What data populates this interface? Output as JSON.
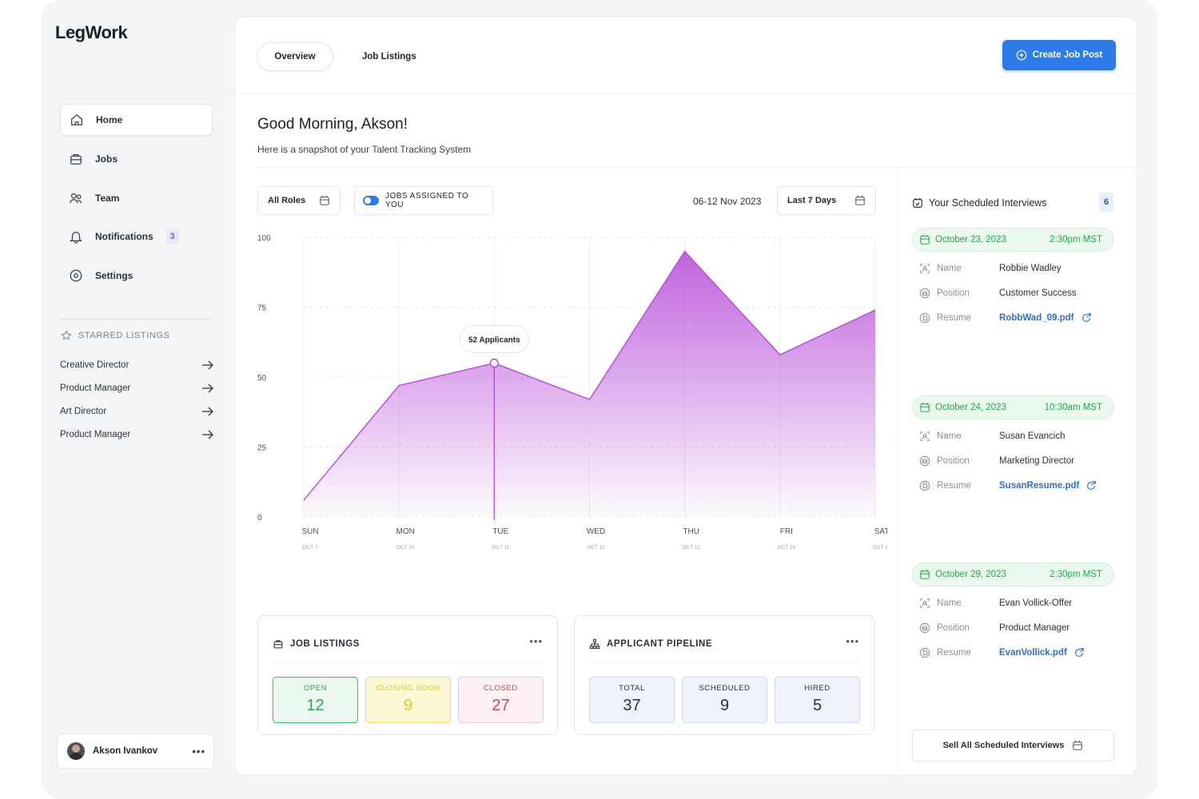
{
  "app": {
    "logo": "LegWork"
  },
  "sidebar": {
    "items": [
      {
        "label": "Home",
        "icon": "home-icon",
        "active": true
      },
      {
        "label": "Jobs",
        "icon": "briefcase-icon"
      },
      {
        "label": "Team",
        "icon": "team-icon"
      },
      {
        "label": "Notifications",
        "icon": "bell-icon",
        "badge": "3"
      },
      {
        "label": "Settings",
        "icon": "settings-icon"
      }
    ],
    "starred_title": "STARRED LISTINGS",
    "starred": [
      "Creative Director",
      "Product Manager",
      "Art Director",
      "Product Manager"
    ],
    "user": {
      "name": "Akson Ivankov"
    }
  },
  "header": {
    "tabs": [
      "Overview",
      "Job Listings"
    ],
    "create_button": "Create Job Post"
  },
  "greeting": {
    "title": "Good Morning, Akson!",
    "subtitle": "Here is a snapshot of your Talent Tracking System"
  },
  "filters": {
    "roles": "All Roles",
    "toggle_label": "JOBS ASSIGNED TO YOU",
    "date_range": "06-12 Nov 2023",
    "period": "Last 7 Days"
  },
  "chart_data": {
    "type": "area",
    "categories": [
      "SUN",
      "MON",
      "TUE",
      "WED",
      "THU",
      "FRI",
      "SAT"
    ],
    "sublabels": [
      "OCT 7",
      "OCT 10",
      "OCT 11",
      "OCT 12",
      "OCT 13",
      "OCT 14",
      "OCT 15"
    ],
    "values": [
      6,
      47,
      55,
      42,
      95,
      58,
      74
    ],
    "ylim": [
      0,
      100
    ],
    "yticks": [
      0,
      25,
      50,
      75,
      100
    ],
    "tooltip": {
      "index": 2,
      "label": "52 Applicants"
    },
    "color": "#b548d8"
  },
  "job_listings": {
    "title": "JOB LISTINGS",
    "boxes": [
      {
        "label": "OPEN",
        "value": "12"
      },
      {
        "label": "CLOSING SOON",
        "value": "9"
      },
      {
        "label": "CLOSED",
        "value": "27"
      }
    ]
  },
  "pipeline": {
    "title": "APPLICANT PIPELINE",
    "boxes": [
      {
        "label": "TOTAL",
        "value": "37"
      },
      {
        "label": "SCHEDULED",
        "value": "9"
      },
      {
        "label": "HIRED",
        "value": "5"
      }
    ]
  },
  "interviews": {
    "title": "Your Scheduled Interviews",
    "count": "6",
    "keys": {
      "name": "Name",
      "position": "Position",
      "resume": "Resume"
    },
    "list": [
      {
        "date": "October 23, 2023",
        "time": "2:30pm MST",
        "name": "Robbie Wadley",
        "position": "Customer Success",
        "resume": "RobbWad_09.pdf"
      },
      {
        "date": "October 24, 2023",
        "time": "10:30am MST",
        "name": "Susan Evancich",
        "position": "Marketing Director",
        "resume": "SusanResume.pdf"
      },
      {
        "date": "October 29, 2023",
        "time": "2:30pm MST",
        "name": "Evan Vollick-Offer",
        "position": "Product Manager",
        "resume": "EvanVollick.pdf"
      }
    ],
    "see_all": "Sell All Scheduled Interviews"
  },
  "colors": {
    "accent": "#2d7be9",
    "success": "#22a84a",
    "chart": "#b548d8"
  }
}
